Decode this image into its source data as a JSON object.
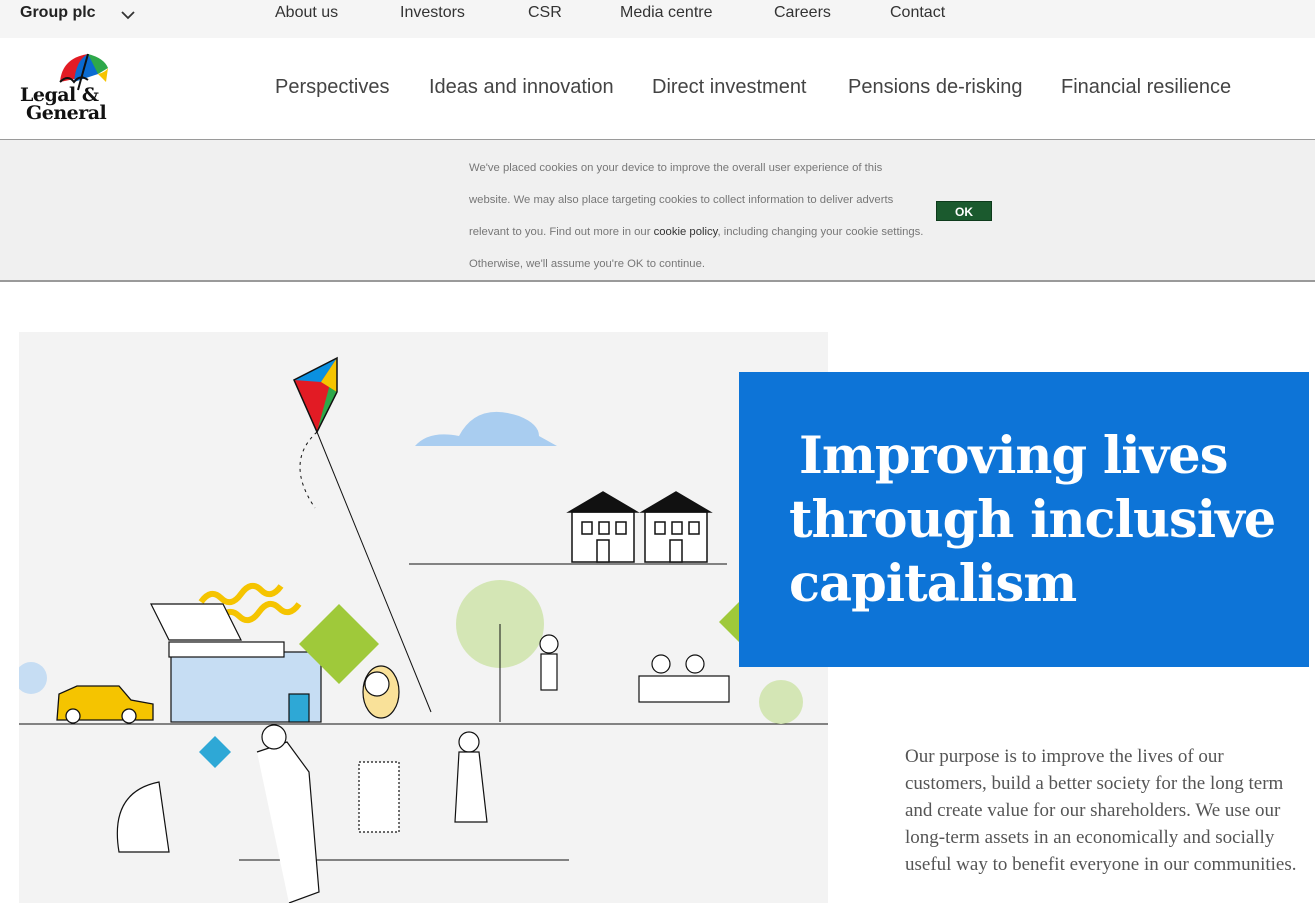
{
  "topbar": {
    "group_label": "Group plc",
    "links": [
      "About us",
      "Investors",
      "CSR",
      "Media centre",
      "Careers",
      "Contact"
    ]
  },
  "logo": {
    "line1": "Legal &",
    "line2": "General"
  },
  "nav": [
    "Perspectives",
    "Ideas and innovation",
    "Direct investment",
    "Pensions de-risking",
    "Financial resilience"
  ],
  "cookie": {
    "text_before": "We've placed cookies on your device to improve the overall user experience of this website. We may also place targeting cookies to collect information to deliver adverts relevant to you. Find out more in our ",
    "link": "cookie policy",
    "text_after": ", including changing your cookie settings. Otherwise, we'll assume you're OK to continue.",
    "ok_label": "OK"
  },
  "hero": {
    "title_lines": [
      "Improving lives",
      "through inclusive",
      "capitalism"
    ],
    "purpose": "Our purpose is to improve the lives of our customers, build a better society for the long term and create value for our shareholders. We use our long-term assets in an economically and socially useful way to benefit everyone in our communities."
  },
  "colors": {
    "hero_blue": "#0d74d7",
    "ok_green": "#1b5a2e",
    "topbar_bg": "#f5f5f5",
    "cookie_bg": "#f0f0f0"
  }
}
